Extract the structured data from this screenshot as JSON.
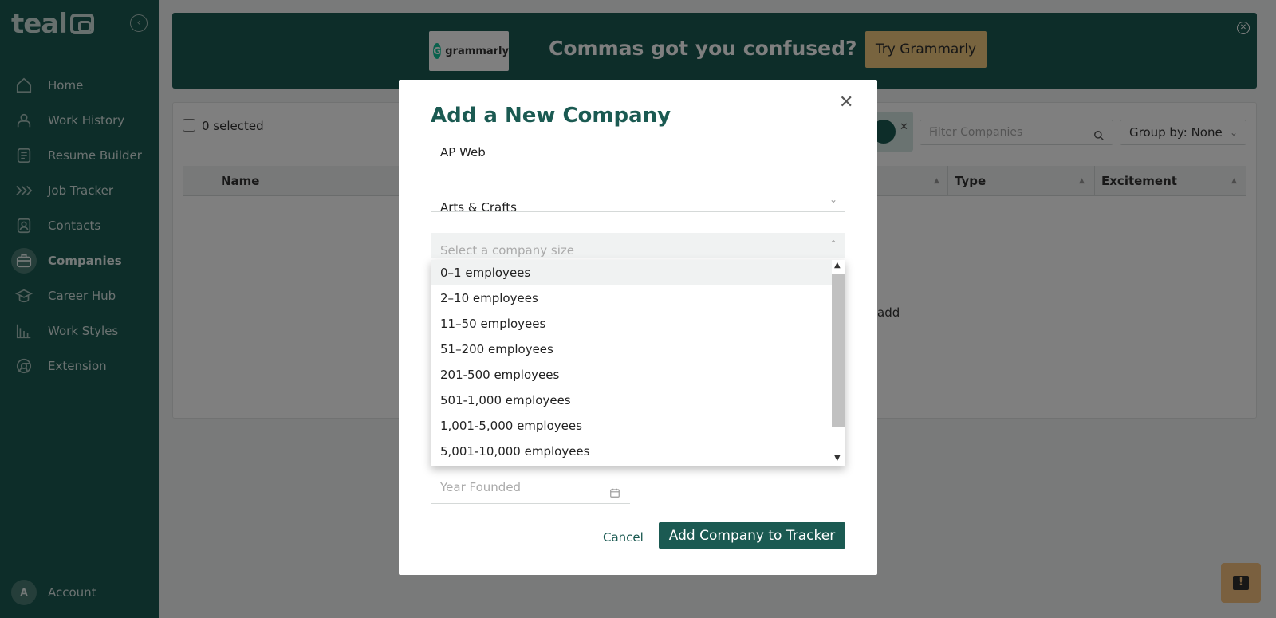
{
  "sidebar": {
    "logo": "teal",
    "items": [
      {
        "label": "Home",
        "icon": "home-icon"
      },
      {
        "label": "Work History",
        "icon": "person-icon"
      },
      {
        "label": "Resume Builder",
        "icon": "document-icon"
      },
      {
        "label": "Job Tracker",
        "icon": "chevrons-icon"
      },
      {
        "label": "Contacts",
        "icon": "contact-card-icon"
      },
      {
        "label": "Companies",
        "icon": "briefcase-icon",
        "active": true
      },
      {
        "label": "Career Hub",
        "icon": "graduation-cap-icon"
      },
      {
        "label": "Work Styles",
        "icon": "bar-chart-icon"
      },
      {
        "label": "Extension",
        "icon": "chrome-icon"
      }
    ],
    "account": {
      "initial": "A",
      "label": "Account"
    }
  },
  "banner": {
    "brand": "grammarly",
    "headline": "Commas got you confused?",
    "cta": "Try Grammarly"
  },
  "toolbar": {
    "selected": "0 selected",
    "filter_placeholder": "Filter Companies",
    "group_by": "Group by: None"
  },
  "table": {
    "columns": [
      "Name",
      "Type",
      "Excitement"
    ],
    "empty_text": "add"
  },
  "modal": {
    "title": "Add a New Company",
    "name_value": "AP Web",
    "industry_value": "Arts & Crafts",
    "size_placeholder": "Select a company size",
    "year_placeholder": "Year Founded",
    "cancel": "Cancel",
    "submit": "Add Company to Tracker"
  },
  "dropdown": {
    "options": [
      "0–1 employees",
      "2–10 employees",
      "11–50 employees",
      "51–200 employees",
      "201-500 employees",
      "501-1,000 employees",
      "1,001-5,000 employees",
      "5,001-10,000 employees"
    ]
  },
  "colors": {
    "brand": "#1b5a52",
    "cta": "#f1c97e"
  }
}
